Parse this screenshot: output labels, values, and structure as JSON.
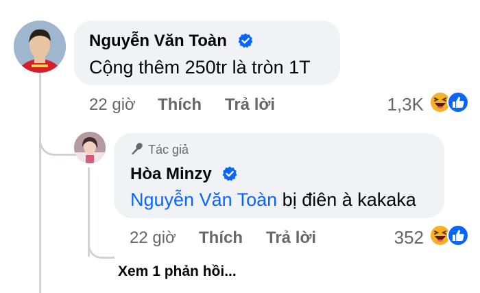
{
  "comment": {
    "author": "Nguyễn Văn Toàn",
    "text": "Cộng thêm 250tr là tròn 1T",
    "time": "22 giờ",
    "like_label": "Thích",
    "reply_label": "Trả lời",
    "reaction_count": "1,3K"
  },
  "reply": {
    "author_badge": "Tác giả",
    "author": "Hòa Minzy",
    "mention": "Nguyễn Văn Toàn",
    "text": " bị điên à kakaka",
    "time": "22 giờ",
    "like_label": "Thích",
    "reply_label": "Trả lời",
    "reaction_count": "352"
  },
  "view_more": "Xem 1 phản hồi...",
  "icons": {
    "verified": "verified-badge-icon",
    "author_badge": "microphone-icon",
    "reactions": [
      "haha-reaction-icon",
      "like-reaction-icon"
    ]
  },
  "colors": {
    "verified": "#0866ff",
    "mention": "#0866ff",
    "bubble": "#f0f2f5",
    "meta_text": "#65676b"
  }
}
